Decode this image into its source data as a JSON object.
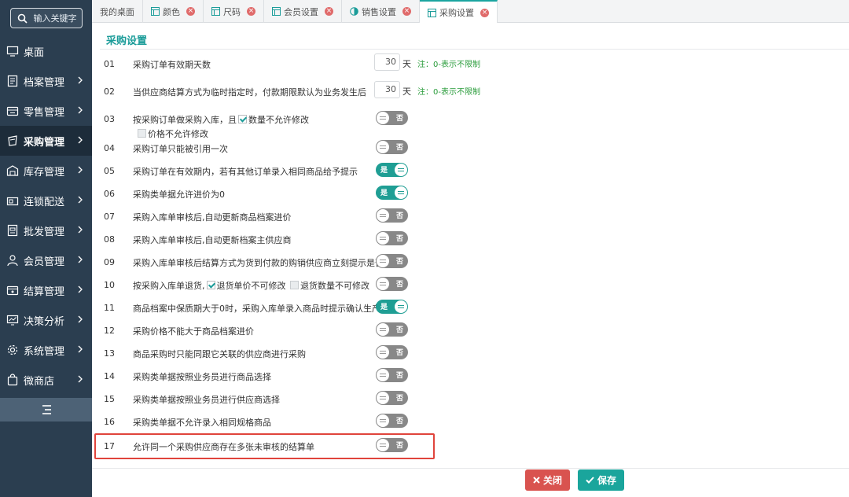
{
  "sidebar": {
    "search_placeholder": "输入关键字",
    "items": [
      {
        "label": "桌面",
        "icon": "monitor-icon",
        "chevron": false,
        "active": false
      },
      {
        "label": "档案管理",
        "icon": "file-list-icon",
        "chevron": true,
        "active": false
      },
      {
        "label": "零售管理",
        "icon": "register-icon",
        "chevron": true,
        "active": false
      },
      {
        "label": "采购管理",
        "icon": "bag-icon",
        "chevron": true,
        "active": true
      },
      {
        "label": "库存管理",
        "icon": "warehouse-icon",
        "chevron": true,
        "active": false
      },
      {
        "label": "连锁配送",
        "icon": "store-icon",
        "chevron": true,
        "active": false
      },
      {
        "label": "批发管理",
        "icon": "invoice-icon",
        "chevron": true,
        "active": false
      },
      {
        "label": "会员管理",
        "icon": "user-icon",
        "chevron": true,
        "active": false
      },
      {
        "label": "结算管理",
        "icon": "cash-icon",
        "chevron": true,
        "active": false
      },
      {
        "label": "决策分析",
        "icon": "chart-icon",
        "chevron": true,
        "active": false
      },
      {
        "label": "系统管理",
        "icon": "gear-icon",
        "chevron": true,
        "active": false
      },
      {
        "label": "微商店",
        "icon": "shop-bag-icon",
        "chevron": true,
        "active": false
      }
    ]
  },
  "tabs": [
    {
      "label": "我的桌面",
      "icon": "",
      "closable": false,
      "active": false
    },
    {
      "label": "颜色",
      "icon": "table-icon",
      "closable": true,
      "active": false
    },
    {
      "label": "尺码",
      "icon": "table-icon",
      "closable": true,
      "active": false
    },
    {
      "label": "会员设置",
      "icon": "table-icon",
      "closable": true,
      "active": false
    },
    {
      "label": "销售设置",
      "icon": "half-circle-icon",
      "closable": true,
      "active": false
    },
    {
      "label": "采购设置",
      "icon": "table-icon",
      "closable": true,
      "active": true
    }
  ],
  "page": {
    "title": "采购设置"
  },
  "settings": [
    {
      "num": "01",
      "label": "采购订单有效期天数",
      "value": "30",
      "unit": "天",
      "note": "注：0-表示不限制"
    },
    {
      "num": "02",
      "label": "当供应商结算方式为临时指定时，付款期限默认为业务发生后",
      "value": "30",
      "unit": "天",
      "note": "注：0-表示不限制"
    },
    {
      "num": "03",
      "label": "按采购订单做采购入库，且",
      "cb1": "数量不允许修改",
      "cb2": "价格不允许修改",
      "toggle": "否"
    },
    {
      "num": "04",
      "label": "采购订单只能被引用一次",
      "toggle": "否"
    },
    {
      "num": "05",
      "label": "采购订单在有效期内，若有其他订单录入相同商品给予提示",
      "toggle": "是"
    },
    {
      "num": "06",
      "label": "采购类单据允许进价为0",
      "toggle": "是"
    },
    {
      "num": "07",
      "label": "采购入库单审核后,自动更新商品档案进价",
      "toggle": "否"
    },
    {
      "num": "08",
      "label": "采购入库单审核后,自动更新档案主供应商",
      "toggle": "否"
    },
    {
      "num": "09",
      "label": "采购入库单审核后结算方式为货到付款的购销供应商立刻提示是否付款",
      "toggle": "否"
    },
    {
      "num": "10",
      "label": "按采购入库单退货,",
      "cb1": "退货单价不可修改",
      "cb2": "退货数量不可修改",
      "toggle": "否"
    },
    {
      "num": "11",
      "label": "商品档案中保质期大于0时，采购入库单录入商品时提示确认生产日期",
      "toggle": "是"
    },
    {
      "num": "12",
      "label": "采购价格不能大于商品档案进价",
      "toggle": "否"
    },
    {
      "num": "13",
      "label": "商品采购时只能同跟它关联的供应商进行采购",
      "toggle": "否"
    },
    {
      "num": "14",
      "label": "采购类单据按照业务员进行商品选择",
      "toggle": "否"
    },
    {
      "num": "15",
      "label": "采购类单据按照业务员进行供应商选择",
      "toggle": "否"
    },
    {
      "num": "16",
      "label": "采购类单据不允许录入相同规格商品",
      "toggle": "否"
    },
    {
      "num": "17",
      "label": "允许同一个采购供应商存在多张未审核的结算单",
      "toggle": "否"
    }
  ],
  "buttons": {
    "close": "关闭",
    "save": "保存"
  },
  "colors": {
    "accent": "#1aa59c",
    "danger": "#d9534f",
    "sidebar": "#2b3e50"
  }
}
